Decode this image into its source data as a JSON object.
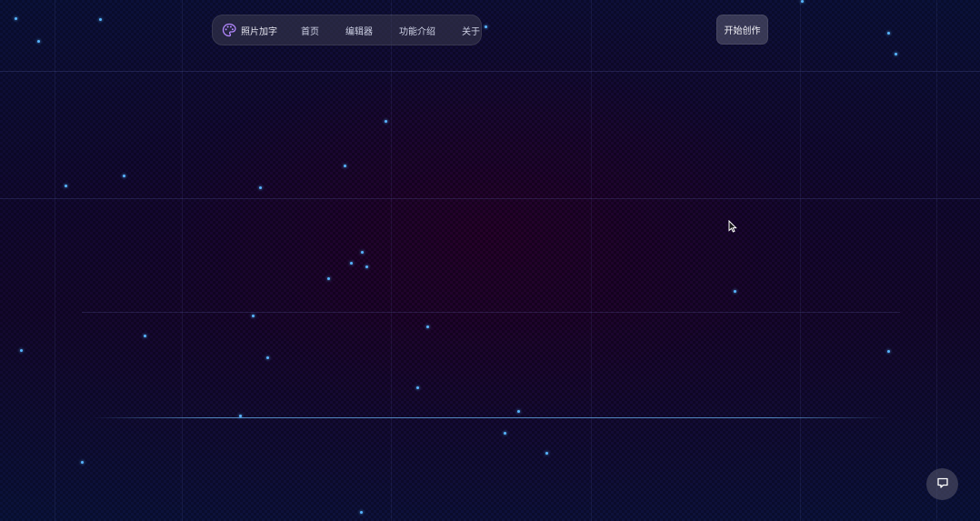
{
  "nav": {
    "brand_label": "照片加字",
    "links": [
      "首页",
      "编辑器",
      "功能介绍",
      "关于"
    ]
  },
  "cta_label": "开始创作",
  "icons": {
    "brand": "palette-icon",
    "chat": "chat-bubble-icon",
    "cursor": "mouse-pointer-icon"
  },
  "colors": {
    "background": "#120a2a",
    "star": "#58b6ff",
    "accent_brand_icon": "#b388ff"
  }
}
